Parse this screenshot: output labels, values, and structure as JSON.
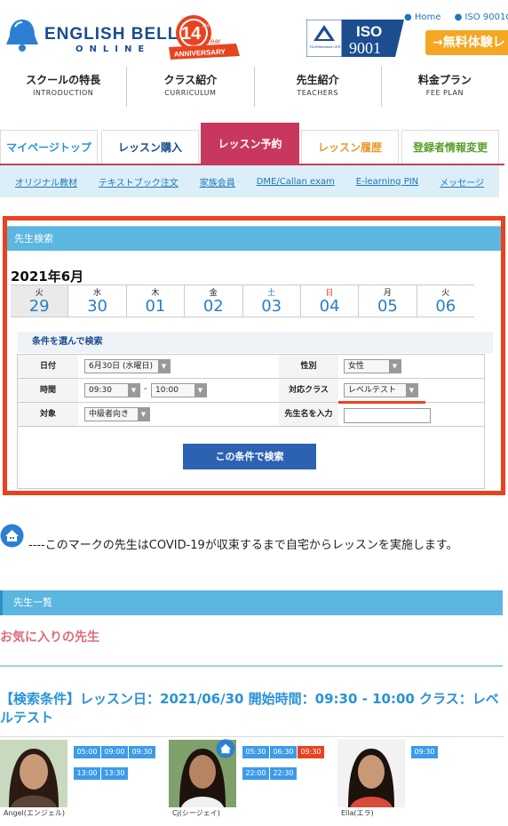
{
  "header": {
    "logo_text": "ENGLISH BELL",
    "logo_reg": "®",
    "logo_sub": "ONLINE",
    "anniv_num": "14",
    "anniv_th": "TH",
    "anniv_year": "Year",
    "anniv_label": "ANNIVERSARY",
    "iso_cert": "TÜVRheinland CERTIFIED",
    "iso_label": "ISO",
    "iso_num": "9001",
    "home_link": "Home",
    "iso_link": "ISO 9001C",
    "trial_label": "→無料体験レ"
  },
  "gnav": [
    {
      "jp": "スクールの特長",
      "en": "INTRODUCTION"
    },
    {
      "jp": "クラス紹介",
      "en": "CURRICULUM"
    },
    {
      "jp": "先生紹介",
      "en": "TEACHERS"
    },
    {
      "jp": "料金プラン",
      "en": "FEE PLAN"
    }
  ],
  "tabs": [
    {
      "label": "マイページトップ",
      "color": "#2a93d5"
    },
    {
      "label": "レッスン購入",
      "color": "#1b4d8f"
    },
    {
      "label": "レッスン予約",
      "color": "#ffffff"
    },
    {
      "label": "レッスン履歴",
      "color": "#e89a2e"
    },
    {
      "label": "登録者情報変更",
      "color": "#5a9e2f"
    }
  ],
  "subnav": [
    "オリジナル教材",
    "テキストブック注文",
    "家族会員",
    "DME/Callan exam",
    "E-learning PIN",
    "メッセージ"
  ],
  "search": {
    "title": "先生検索",
    "month": "2021年6月",
    "dates": [
      {
        "dow": "火",
        "day": "29",
        "dow_color": "#222222"
      },
      {
        "dow": "水",
        "day": "30",
        "dow_color": "#222222"
      },
      {
        "dow": "木",
        "day": "01",
        "dow_color": "#222222"
      },
      {
        "dow": "金",
        "day": "02",
        "dow_color": "#222222"
      },
      {
        "dow": "土",
        "day": "03",
        "dow_color": "#2a7fc1"
      },
      {
        "dow": "日",
        "day": "04",
        "dow_color": "#e8431f"
      },
      {
        "dow": "月",
        "day": "05",
        "dow_color": "#222222"
      },
      {
        "dow": "火",
        "day": "06",
        "dow_color": "#222222"
      }
    ],
    "condition_title": "条件を選んで検索",
    "date_label": "日付",
    "date_value": "6月30日 (水曜日)",
    "gender_label": "性別",
    "gender_value": "女性",
    "time_label": "時間",
    "time_from": "09:30",
    "time_sep": "-",
    "time_to": "10:00",
    "class_label": "対応クラス",
    "class_value": "レベルテスト",
    "target_label": "対象",
    "target_value": "中級者向き",
    "name_label": "先生名を入力",
    "name_value": "",
    "button": "この条件で検索"
  },
  "covid_note": "----このマークの先生はCOVID-19が収束するまで自宅からレッスンを実施します。",
  "teacher_list_title": "先生一覧",
  "favorites_title": "お気に入りの先生",
  "conditions_text": "【検索条件】レッスン日：2021/06/30 開始時間：09:30 - 10:00 クラス：レベルテスト",
  "teachers": [
    {
      "name": "Angel(エンジェル)",
      "home": false,
      "slots": [
        "05:00",
        "09:00",
        "09:30",
        "13:00",
        "13:30"
      ],
      "red_slots": []
    },
    {
      "name": "Cj(シージェイ)",
      "home": true,
      "slots": [
        "05:30",
        "06:30",
        "09:30",
        "22:00",
        "22:30"
      ],
      "red_slots": [
        "09:30"
      ]
    },
    {
      "name": "Ella(エラ)",
      "home": false,
      "slots": [
        "09:30"
      ],
      "red_slots": []
    }
  ],
  "colors": {
    "accent": "#c8385e",
    "link": "#1b78b8",
    "bar": "#5bb6e0",
    "highlight": "#e8431f",
    "slot": "#3d9be9"
  }
}
